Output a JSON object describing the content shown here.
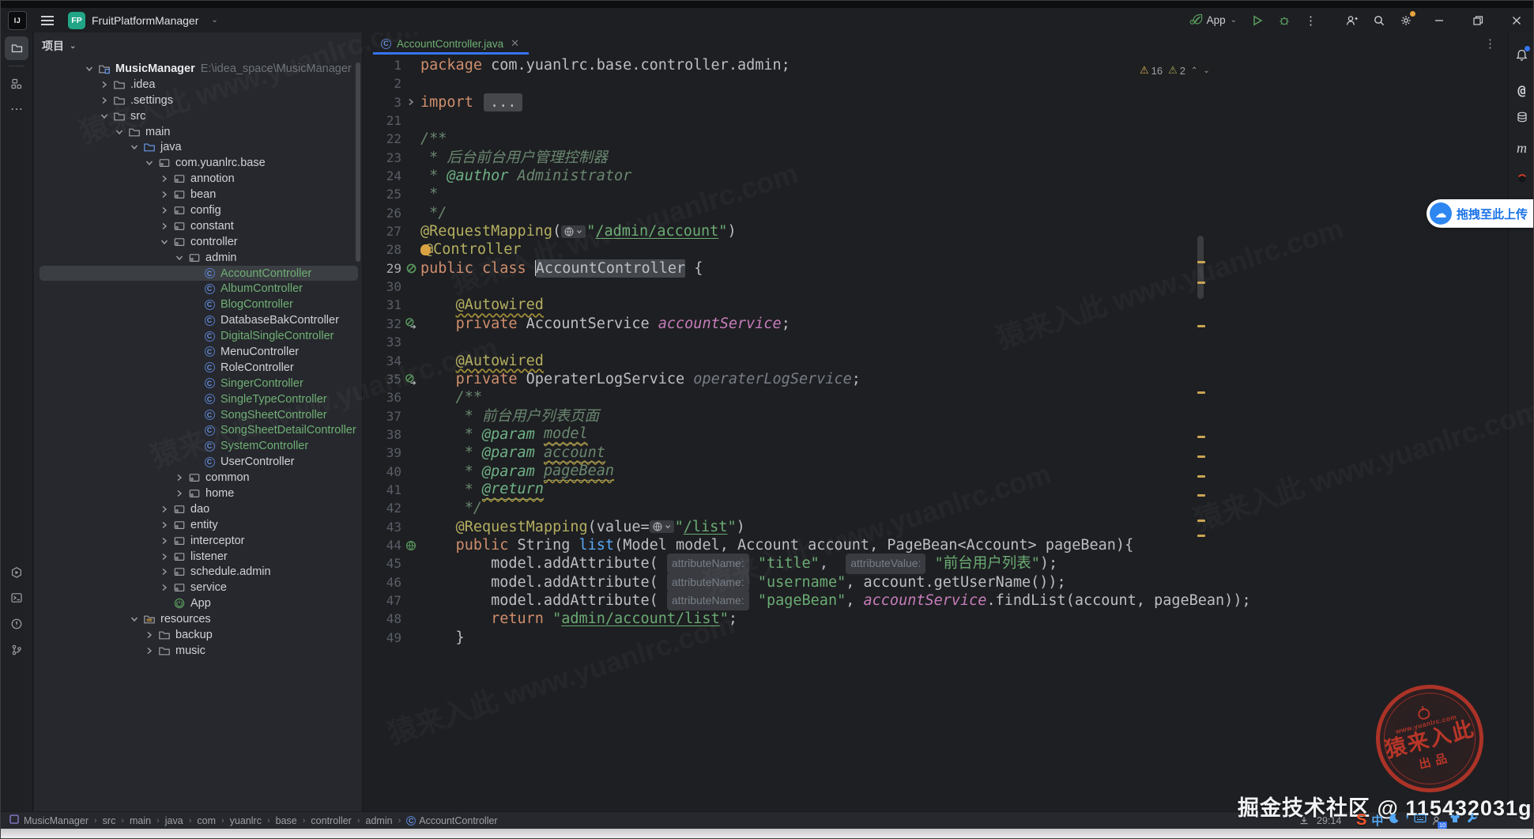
{
  "colors": {
    "accent": "#3574F0",
    "vcs_added_green": "#6FAF74",
    "warning_yellow": "#C9A554",
    "stamp_red": "#C73829",
    "run_green": "#57965C"
  },
  "titlebar": {
    "project_badge": "FP",
    "project_name": "FruitPlatformManager",
    "run_widget": {
      "config_name": "App"
    }
  },
  "tool_stripes": {
    "left_top": [
      "project",
      "structure",
      "more"
    ],
    "left_bottom": [
      "run",
      "terminal",
      "problems",
      "version-control"
    ],
    "right": [
      "notifications",
      "ai-assistant",
      "database",
      "maven",
      "plugin"
    ]
  },
  "project_panel": {
    "header": "项目",
    "tree": [
      {
        "level": 1,
        "chevron": "down",
        "icon": "root",
        "label": "MusicManager",
        "style": "root",
        "path": "E:\\idea_space\\MusicManager",
        "selected": false
      },
      {
        "level": 2,
        "chevron": "right",
        "icon": "folder",
        "label": ".idea",
        "style": "w",
        "selected": false
      },
      {
        "level": 2,
        "chevron": "right",
        "icon": "folder",
        "label": ".settings",
        "style": "w",
        "selected": false
      },
      {
        "level": 2,
        "chevron": "down",
        "icon": "folder",
        "label": "src",
        "style": "w",
        "selected": false
      },
      {
        "level": 3,
        "chevron": "down",
        "icon": "folder",
        "label": "main",
        "style": "w",
        "selected": false
      },
      {
        "level": 4,
        "chevron": "down",
        "icon": "folderB",
        "label": "java",
        "style": "w",
        "selected": false
      },
      {
        "level": 5,
        "chevron": "down",
        "icon": "pkg",
        "label": "com.yuanlrc.base",
        "style": "w",
        "selected": false
      },
      {
        "level": 6,
        "chevron": "right",
        "icon": "pkg",
        "label": "annotion",
        "style": "w",
        "selected": false
      },
      {
        "level": 6,
        "chevron": "right",
        "icon": "pkg",
        "label": "bean",
        "style": "w",
        "selected": false
      },
      {
        "level": 6,
        "chevron": "right",
        "icon": "pkg",
        "label": "config",
        "style": "w",
        "selected": false
      },
      {
        "level": 6,
        "chevron": "right",
        "icon": "pkg",
        "label": "constant",
        "style": "w",
        "selected": false
      },
      {
        "level": 6,
        "chevron": "down",
        "icon": "pkg",
        "label": "controller",
        "style": "w",
        "selected": false
      },
      {
        "level": 7,
        "chevron": "down",
        "icon": "pkg",
        "label": "admin",
        "style": "w",
        "selected": false
      },
      {
        "level": 8,
        "chevron": "none",
        "icon": "cls",
        "label": "AccountController",
        "style": "g",
        "selected": true
      },
      {
        "level": 8,
        "chevron": "none",
        "icon": "cls",
        "label": "AlbumController",
        "style": "g",
        "selected": false
      },
      {
        "level": 8,
        "chevron": "none",
        "icon": "cls",
        "label": "BlogController",
        "style": "g",
        "selected": false
      },
      {
        "level": 8,
        "chevron": "none",
        "icon": "cls",
        "label": "DatabaseBakController",
        "style": "w",
        "selected": false
      },
      {
        "level": 8,
        "chevron": "none",
        "icon": "cls",
        "label": "DigitalSingleController",
        "style": "g",
        "selected": false
      },
      {
        "level": 8,
        "chevron": "none",
        "icon": "cls",
        "label": "MenuController",
        "style": "w",
        "selected": false
      },
      {
        "level": 8,
        "chevron": "none",
        "icon": "cls",
        "label": "RoleController",
        "style": "w",
        "selected": false
      },
      {
        "level": 8,
        "chevron": "none",
        "icon": "cls",
        "label": "SingerController",
        "style": "g",
        "selected": false
      },
      {
        "level": 8,
        "chevron": "none",
        "icon": "cls",
        "label": "SingleTypeController",
        "style": "g",
        "selected": false
      },
      {
        "level": 8,
        "chevron": "none",
        "icon": "cls",
        "label": "SongSheetController",
        "style": "g",
        "selected": false
      },
      {
        "level": 8,
        "chevron": "none",
        "icon": "cls",
        "label": "SongSheetDetailController",
        "style": "g",
        "selected": false
      },
      {
        "level": 8,
        "chevron": "none",
        "icon": "cls",
        "label": "SystemController",
        "style": "g",
        "selected": false
      },
      {
        "level": 8,
        "chevron": "none",
        "icon": "cls",
        "label": "UserController",
        "style": "w",
        "selected": false
      },
      {
        "level": 7,
        "chevron": "right",
        "icon": "pkg",
        "label": "common",
        "style": "w",
        "selected": false
      },
      {
        "level": 7,
        "chevron": "right",
        "icon": "pkg",
        "label": "home",
        "style": "w",
        "selected": false
      },
      {
        "level": 6,
        "chevron": "right",
        "icon": "pkg",
        "label": "dao",
        "style": "w",
        "selected": false
      },
      {
        "level": 6,
        "chevron": "right",
        "icon": "pkg",
        "label": "entity",
        "style": "w",
        "selected": false
      },
      {
        "level": 6,
        "chevron": "right",
        "icon": "pkg",
        "label": "interceptor",
        "style": "w",
        "selected": false
      },
      {
        "level": 6,
        "chevron": "right",
        "icon": "pkg",
        "label": "listener",
        "style": "w",
        "selected": false
      },
      {
        "level": 6,
        "chevron": "right",
        "icon": "pkg",
        "label": "schedule.admin",
        "style": "w",
        "selected": false
      },
      {
        "level": 6,
        "chevron": "right",
        "icon": "pkg",
        "label": "service",
        "style": "w",
        "selected": false
      },
      {
        "level": 6,
        "chevron": "none",
        "icon": "app",
        "label": "App",
        "style": "w",
        "selected": false
      },
      {
        "level": 4,
        "chevron": "down",
        "icon": "res",
        "label": "resources",
        "style": "w",
        "selected": false
      },
      {
        "level": 5,
        "chevron": "right",
        "icon": "folder",
        "label": "backup",
        "style": "w",
        "selected": false
      },
      {
        "level": 5,
        "chevron": "right",
        "icon": "folder",
        "label": "music",
        "style": "w",
        "selected": false
      }
    ]
  },
  "editor": {
    "tab": {
      "name": "AccountController.java"
    },
    "inspections": {
      "warnings": "16",
      "weak_warnings": "2"
    },
    "stripe_marks": [
      259,
      285,
      340,
      424,
      480,
      505,
      530,
      554,
      586,
      605
    ],
    "code": {
      "lines": [
        {
          "n": "1",
          "gutter": "",
          "current": false,
          "segs": [
            [
              "kw",
              "package "
            ],
            [
              "pl",
              "com.yuanlrc.base.controller.admin;"
            ]
          ]
        },
        {
          "n": "2",
          "gutter": "",
          "current": false,
          "segs": []
        },
        {
          "n": "3",
          "gutter": "fold",
          "current": false,
          "segs": [
            [
              "kw",
              "import "
            ],
            [
              "fold",
              "..."
            ]
          ]
        },
        {
          "n": "21",
          "gutter": "",
          "current": false,
          "segs": []
        },
        {
          "n": "22",
          "gutter": "",
          "current": false,
          "segs": [
            [
              "cmt",
              "/**"
            ]
          ]
        },
        {
          "n": "23",
          "gutter": "",
          "current": false,
          "segs": [
            [
              "cmt",
              " * 后台前台用户管理控制器"
            ]
          ]
        },
        {
          "n": "24",
          "gutter": "",
          "current": false,
          "segs": [
            [
              "cmt",
              " * "
            ],
            [
              "tag",
              "@author"
            ],
            [
              "cmt",
              " Administrator"
            ]
          ]
        },
        {
          "n": "25",
          "gutter": "",
          "current": false,
          "segs": [
            [
              "cmt",
              " *"
            ]
          ]
        },
        {
          "n": "26",
          "gutter": "",
          "current": false,
          "segs": [
            [
              "cmt",
              " */"
            ]
          ]
        },
        {
          "n": "27",
          "gutter": "",
          "current": false,
          "segs": [
            [
              "ann",
              "@RequestMapping"
            ],
            [
              "pl",
              "("
            ],
            [
              "globe",
              ""
            ],
            [
              "str",
              "\""
            ],
            [
              "stru",
              "/admin/account"
            ],
            [
              "str",
              "\""
            ],
            [
              "pl",
              ")"
            ]
          ]
        },
        {
          "n": "28",
          "gutter": "",
          "current": false,
          "segs": [
            [
              "bulb",
              ""
            ],
            [
              "ann",
              "@Controller"
            ]
          ]
        },
        {
          "n": "29",
          "gutter": "bean",
          "current": true,
          "segs": [
            [
              "kw",
              "public class "
            ],
            [
              "caret",
              ""
            ],
            [
              "selbox",
              "AccountController"
            ],
            [
              "pl",
              " {"
            ]
          ]
        },
        {
          "n": "30",
          "gutter": "",
          "current": false,
          "segs": []
        },
        {
          "n": "31",
          "gutter": "",
          "current": false,
          "segs": [
            [
              "pl",
              "    "
            ],
            [
              "annw",
              "@Autowired"
            ]
          ]
        },
        {
          "n": "32",
          "gutter": "beanArrow",
          "current": false,
          "segs": [
            [
              "pl",
              "    "
            ],
            [
              "kw",
              "private "
            ],
            [
              "pl",
              "AccountService "
            ],
            [
              "fld",
              "accountService"
            ],
            [
              "pl",
              ";"
            ]
          ]
        },
        {
          "n": "33",
          "gutter": "",
          "current": false,
          "segs": []
        },
        {
          "n": "34",
          "gutter": "",
          "current": false,
          "segs": [
            [
              "pl",
              "    "
            ],
            [
              "annw",
              "@Autowired"
            ]
          ]
        },
        {
          "n": "35",
          "gutter": "beanArrow",
          "current": false,
          "segs": [
            [
              "pl",
              "    "
            ],
            [
              "kw",
              "private "
            ],
            [
              "pl",
              "OperaterLogService "
            ],
            [
              "gray",
              "operaterLogService"
            ],
            [
              "pl",
              ";"
            ]
          ]
        },
        {
          "n": "36",
          "gutter": "",
          "current": false,
          "segs": [
            [
              "cmt",
              "    /**"
            ]
          ]
        },
        {
          "n": "37",
          "gutter": "",
          "current": false,
          "segs": [
            [
              "cmt",
              "     * 前台用户列表页面"
            ]
          ]
        },
        {
          "n": "38",
          "gutter": "",
          "current": false,
          "segs": [
            [
              "cmt",
              "     * "
            ],
            [
              "tag",
              "@param"
            ],
            [
              "cmt",
              " "
            ],
            [
              "pw",
              "model"
            ]
          ]
        },
        {
          "n": "39",
          "gutter": "",
          "current": false,
          "segs": [
            [
              "cmt",
              "     * "
            ],
            [
              "tag",
              "@param"
            ],
            [
              "cmt",
              " "
            ],
            [
              "pw",
              "account"
            ]
          ]
        },
        {
          "n": "40",
          "gutter": "",
          "current": false,
          "segs": [
            [
              "cmt",
              "     * "
            ],
            [
              "tag",
              "@param"
            ],
            [
              "cmt",
              " "
            ],
            [
              "pw",
              "pageBean"
            ]
          ]
        },
        {
          "n": "41",
          "gutter": "",
          "current": false,
          "segs": [
            [
              "cmt",
              "     * "
            ],
            [
              "tagw",
              "@return"
            ]
          ]
        },
        {
          "n": "42",
          "gutter": "",
          "current": false,
          "segs": [
            [
              "cmt",
              "     */"
            ]
          ]
        },
        {
          "n": "43",
          "gutter": "",
          "current": false,
          "segs": [
            [
              "pl",
              "    "
            ],
            [
              "ann",
              "@RequestMapping"
            ],
            [
              "pl",
              "(value="
            ],
            [
              "globe",
              ""
            ],
            [
              "str",
              "\""
            ],
            [
              "stru",
              "/list"
            ],
            [
              "str",
              "\""
            ],
            [
              "pl",
              ")"
            ]
          ]
        },
        {
          "n": "44",
          "gutter": "mapping",
          "current": false,
          "segs": [
            [
              "pl",
              "    "
            ],
            [
              "kw",
              "public "
            ],
            [
              "pl",
              "String "
            ],
            [
              "meth",
              "list"
            ],
            [
              "pl",
              "(Model model, Account account, PageBean<Account> pageBean){"
            ]
          ]
        },
        {
          "n": "45",
          "gutter": "",
          "current": false,
          "segs": [
            [
              "pl",
              "        model.addAttribute( "
            ],
            [
              "hint",
              "attributeName:"
            ],
            [
              "str",
              " \"title\""
            ],
            [
              "pl",
              ",  "
            ],
            [
              "hint",
              "attributeValue:"
            ],
            [
              "str",
              " \"前台用户列表\""
            ],
            [
              "pl",
              ");"
            ]
          ]
        },
        {
          "n": "46",
          "gutter": "",
          "current": false,
          "segs": [
            [
              "pl",
              "        model.addAttribute( "
            ],
            [
              "hint",
              "attributeName:"
            ],
            [
              "str",
              " \"username\""
            ],
            [
              "pl",
              ", account.getUserName());"
            ]
          ]
        },
        {
          "n": "47",
          "gutter": "",
          "current": false,
          "segs": [
            [
              "pl",
              "        model.addAttribute( "
            ],
            [
              "hint",
              "attributeName:"
            ],
            [
              "str",
              " \"pageBean\""
            ],
            [
              "pl",
              ", "
            ],
            [
              "fld",
              "accountService"
            ],
            [
              "pl",
              ".findList(account, pageBean));"
            ]
          ]
        },
        {
          "n": "48",
          "gutter": "",
          "current": false,
          "segs": [
            [
              "pl",
              "        "
            ],
            [
              "kw",
              "return "
            ],
            [
              "str",
              "\""
            ],
            [
              "stru",
              "admin/account/list"
            ],
            [
              "str",
              "\""
            ],
            [
              "pl",
              ";"
            ]
          ]
        },
        {
          "n": "49",
          "gutter": "",
          "current": false,
          "segs": [
            [
              "pl",
              "    }"
            ]
          ]
        }
      ]
    }
  },
  "breadcrumbs": {
    "items": [
      "MusicManager",
      "src",
      "main",
      "java",
      "com",
      "yuanlrc",
      "base",
      "controller",
      "admin",
      "AccountController"
    ]
  },
  "status": {
    "caret_position": "29:14"
  },
  "overlays": {
    "upload_chip": {
      "label": "拖拽至此上传"
    },
    "stamp": {
      "text_main": "猿来入此",
      "text_sub": "出品",
      "url": "www.yuanlrc.com"
    },
    "watermark": "掘金技术社区 @ 115432031g",
    "pattern_text": "猿来入此 www.yuanlrc.com",
    "ime_tray": [
      "sogou",
      "chinese-mode",
      "moon",
      "punctuation",
      "keyboard",
      "user",
      "skin",
      "tools"
    ]
  }
}
